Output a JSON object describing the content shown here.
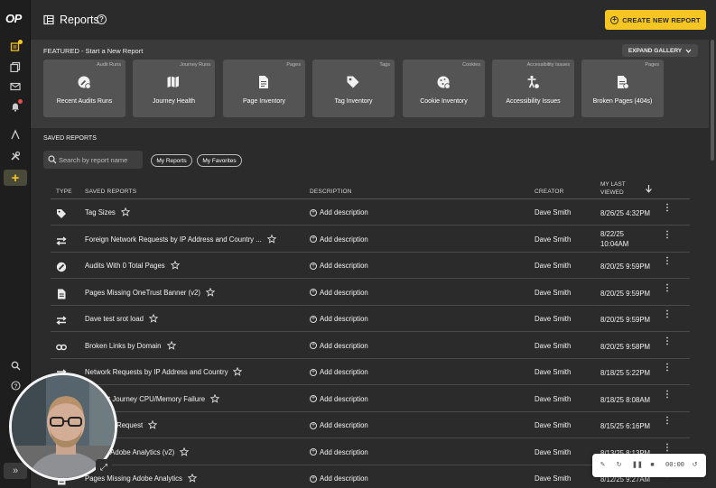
{
  "app": {
    "logo": "OP",
    "title": "Reports",
    "help_glyph": "?"
  },
  "header": {
    "create_label": "CREATE NEW REPORT"
  },
  "featured": {
    "title": "FEATURED - Start a New Report",
    "expand_label": "EXPAND GALLERY",
    "cards": [
      {
        "category": "Audit Runs",
        "label": "Recent Audits Runs",
        "icon": "audit-run-icon"
      },
      {
        "category": "Journey Runs",
        "label": "Journey Health",
        "icon": "journey-map-icon"
      },
      {
        "category": "Pages",
        "label": "Page Inventory",
        "icon": "page-doc-icon"
      },
      {
        "category": "Tags",
        "label": "Tag Inventory",
        "icon": "tag-icon"
      },
      {
        "category": "Cookies",
        "label": "Cookie Inventory",
        "icon": "cookie-icon"
      },
      {
        "category": "Accessibility Issues",
        "label": "Accessibility Issues",
        "icon": "accessibility-icon"
      },
      {
        "category": "Pages",
        "label": "Broken Pages (404s)",
        "icon": "broken-page-icon"
      }
    ]
  },
  "saved": {
    "title": "SAVED REPORTS",
    "search_placeholder": "Search by report name",
    "filters": [
      "My Reports",
      "My Favorites"
    ],
    "columns": {
      "type": "TYPE",
      "name": "SAVED REPORTS",
      "description": "DESCRIPTION",
      "creator": "CREATOR",
      "last_viewed_1": "MY LAST",
      "last_viewed_2": "VIEWED"
    },
    "add_description": "Add description",
    "rows": [
      {
        "type_icon": "tag-icon",
        "name": "Tag Sizes",
        "creator": "Dave Smith",
        "viewed": "8/26/25 4:32PM"
      },
      {
        "type_icon": "network-arrows-icon",
        "name": "Foreign Network Requests by IP Address and Country ...",
        "creator": "Dave Smith",
        "viewed": "8/22/25",
        "viewed2": "10:04AM"
      },
      {
        "type_icon": "audit-run-icon",
        "name": "Audits With 0 Total Pages",
        "creator": "Dave Smith",
        "viewed": "8/20/25 9:59PM"
      },
      {
        "type_icon": "page-doc-icon",
        "name": "Pages Missing OneTrust Banner (v2)",
        "creator": "Dave Smith",
        "viewed": "8/20/25 9:59PM"
      },
      {
        "type_icon": "network-arrows-icon",
        "name": "Dave test srot load",
        "creator": "Dave Smith",
        "viewed": "8/20/25 9:59PM"
      },
      {
        "type_icon": "link-icon",
        "name": "Broken Links by Domain",
        "creator": "Dave Smith",
        "viewed": "8/20/25 9:58PM"
      },
      {
        "type_icon": "network-arrows-icon",
        "name": "Network Requests by IP Address and Country",
        "creator": "Dave Smith",
        "viewed": "8/18/25 5:22PM"
      },
      {
        "type_icon": "journey-map-icon",
        "name": "Account Journey CPU/Memory Failure",
        "creator": "Dave Smith",
        "viewed": "8/18/25 8:08AM"
      },
      {
        "type_icon": "network-arrows-icon",
        "name": "t Network Request",
        "creator": "Dave Smith",
        "viewed": "8/15/25 6:16PM"
      },
      {
        "type_icon": "page-doc-icon",
        "name": "Missing Adobe Analytics (v2)",
        "creator": "Dave Smith",
        "viewed": "8/13/25 8:13PM"
      },
      {
        "type_icon": "page-doc-icon",
        "name": "Pages Missing Adobe Analytics",
        "creator": "Dave Smith",
        "viewed": "8/12/25 9:27AM"
      }
    ]
  },
  "recorder": {
    "time": "00:00"
  },
  "colors": {
    "accent": "#f5c623",
    "background": "#2b2b2b",
    "rail": "#1e1e1e",
    "card": "#545454"
  }
}
